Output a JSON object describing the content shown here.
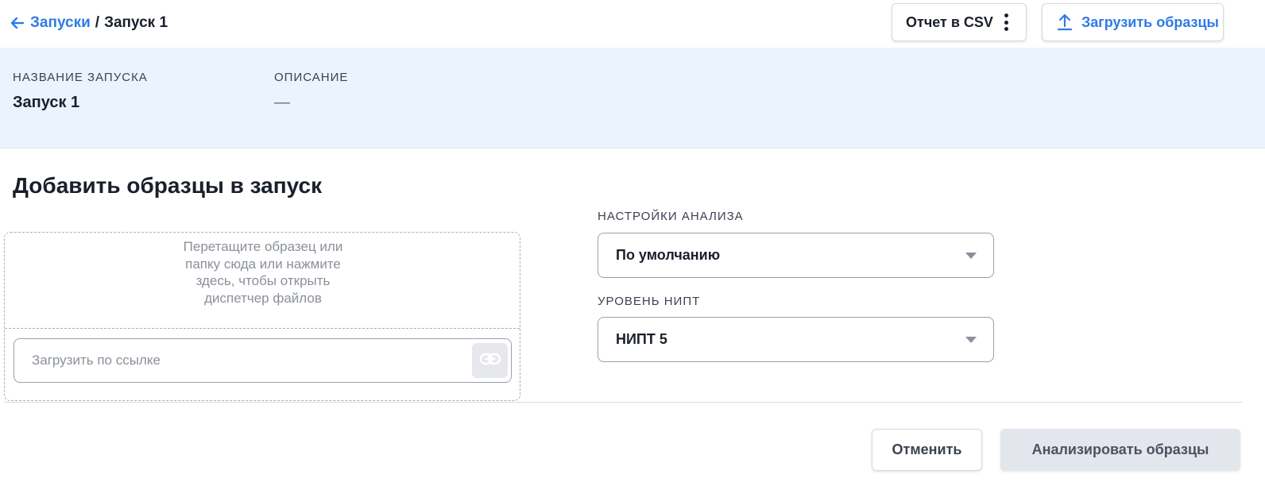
{
  "breadcrumb": {
    "parent": "Запуски",
    "separator": "/",
    "current": "Запуск 1"
  },
  "toolbar": {
    "csv_label": "Отчет в CSV",
    "upload_label": "Загрузить образцы"
  },
  "run_info": {
    "name_label": "НАЗВАНИЕ ЗАПУСКА",
    "name_value": "Запуск 1",
    "description_label": "ОПИСАНИЕ",
    "description_value": "—"
  },
  "add_samples": {
    "title": "Добавить образцы в запуск",
    "dropzone_text": "Перетащите образец или папку сюда или нажмите здесь, чтобы открыть диспетчер файлов",
    "url_value": "",
    "url_placeholder": "Загрузить по ссылке"
  },
  "analysis": {
    "settings_label": "НАСТРОЙКИ АНАЛИЗА",
    "settings_value": "По умолчанию",
    "nipt_label": "УРОВЕНЬ НИПТ",
    "nipt_value": "НИПТ 5"
  },
  "footer": {
    "cancel_label": "Отменить",
    "analyze_label": "Анализировать образцы"
  },
  "colors": {
    "accent": "#2f7be6",
    "info_band": "#ebf3fe",
    "disabled_button": "#e3e6ec"
  },
  "icons": [
    "arrow-left-icon",
    "kebab-menu-icon",
    "upload-icon",
    "link-icon",
    "chevron-down-icon"
  ]
}
